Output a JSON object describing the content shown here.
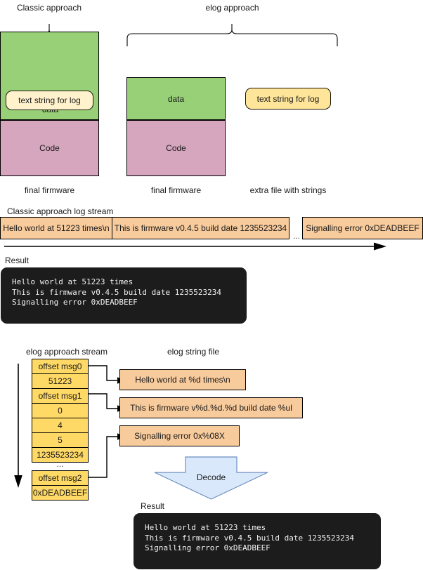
{
  "top": {
    "classic_title": "Classic approach",
    "elog_title": "elog approach",
    "classic_firmware": {
      "data_label": "data",
      "code_label": "Code",
      "embedded_string": "text string for log",
      "caption": "final firmware"
    },
    "elog_firmware": {
      "data_label": "data",
      "code_label": "Code",
      "caption": "final firmware"
    },
    "elog_extra_file": {
      "string": "text string for log",
      "caption": "extra file with strings"
    }
  },
  "classic_stream": {
    "title": "Classic approach log stream",
    "cells": [
      "Hello world at 51223 times\\n",
      "This is firmware v0.4.5 build date 1235523234",
      "...",
      "Signalling error 0xDEADBEEF"
    ]
  },
  "classic_result": {
    "title": "Result",
    "lines": [
      "Hello world at 51223 times",
      "This is firmware v0.4.5 build date 1235523234",
      "Signalling error 0xDEADBEEF"
    ]
  },
  "elog_stream": {
    "title": "elog approach stream",
    "group1": [
      "offset msg0",
      "51223",
      "offset msg1",
      "0",
      "4",
      "5",
      "1235523234"
    ],
    "ellipsis": "...",
    "group2": [
      "offset msg2",
      "0xDEADBEEF"
    ]
  },
  "elog_string_file": {
    "title": "elog string file",
    "entries": [
      "Hello world at %d times\\n",
      "This is firmware v%d.%d.%d build date %ul",
      "Signalling error 0x%08X"
    ]
  },
  "decode": {
    "label": "Decode"
  },
  "elog_result": {
    "title": "Result",
    "lines": [
      "Hello world at 51223 times",
      "This is firmware v0.4.5 build date 1235523234",
      "Signalling error 0xDEADBEEF"
    ]
  },
  "colors": {
    "data_green": "#97d077",
    "code_purple": "#d5a6bd",
    "string_yellow_pale": "#fff2cc",
    "string_yellow": "#ffe599",
    "stream_orange": "#f8cb9c",
    "table_yellow": "#ffd966",
    "decode_blue": "#dae8fc",
    "decode_blue_border": "#6c8ebf",
    "console_bg": "#1c1c1c"
  }
}
